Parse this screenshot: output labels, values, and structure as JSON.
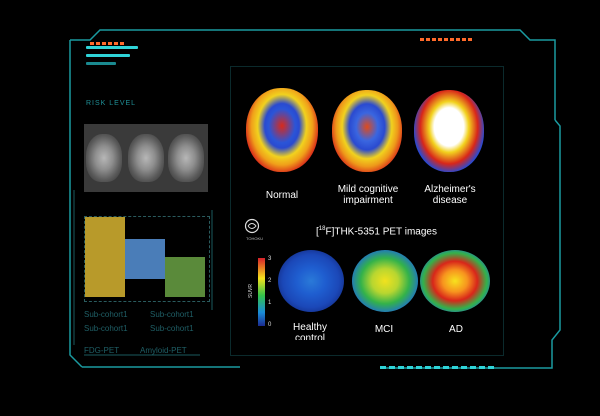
{
  "hud": {
    "risk_label": "RISK LEVEL",
    "cohorts": [
      "Sub-cohort1",
      "Sub-cohort1",
      "Sub-cohort1",
      "Sub-cohort1"
    ],
    "fdg_label": "FDG-PET",
    "amyloid_label": "Amyloid-PET"
  },
  "figure": {
    "top_row": [
      {
        "label": "Normal"
      },
      {
        "label": "Mild cognitive\nimpairment"
      },
      {
        "label": "Alzheimer's\ndisease"
      }
    ],
    "tracer_title_pre": "[",
    "tracer_title_sup": "18",
    "tracer_title_post": "F]THK-5351 PET images",
    "colorbar": {
      "ticks": [
        "3",
        "2",
        "1",
        "0"
      ],
      "unit_label": "SUVR"
    },
    "bottom_row": [
      {
        "label": "Healthy\ncontrol"
      },
      {
        "label": "MCI"
      },
      {
        "label": "AD"
      }
    ],
    "logo_text": "TOHOKU"
  },
  "colors": {
    "accent": "#2fd4d8",
    "accent_orange": "#ff6a2a",
    "grid_yellow": "#b89a2a",
    "grid_blue": "#4a7db8",
    "grid_green": "#5a8a3a"
  }
}
